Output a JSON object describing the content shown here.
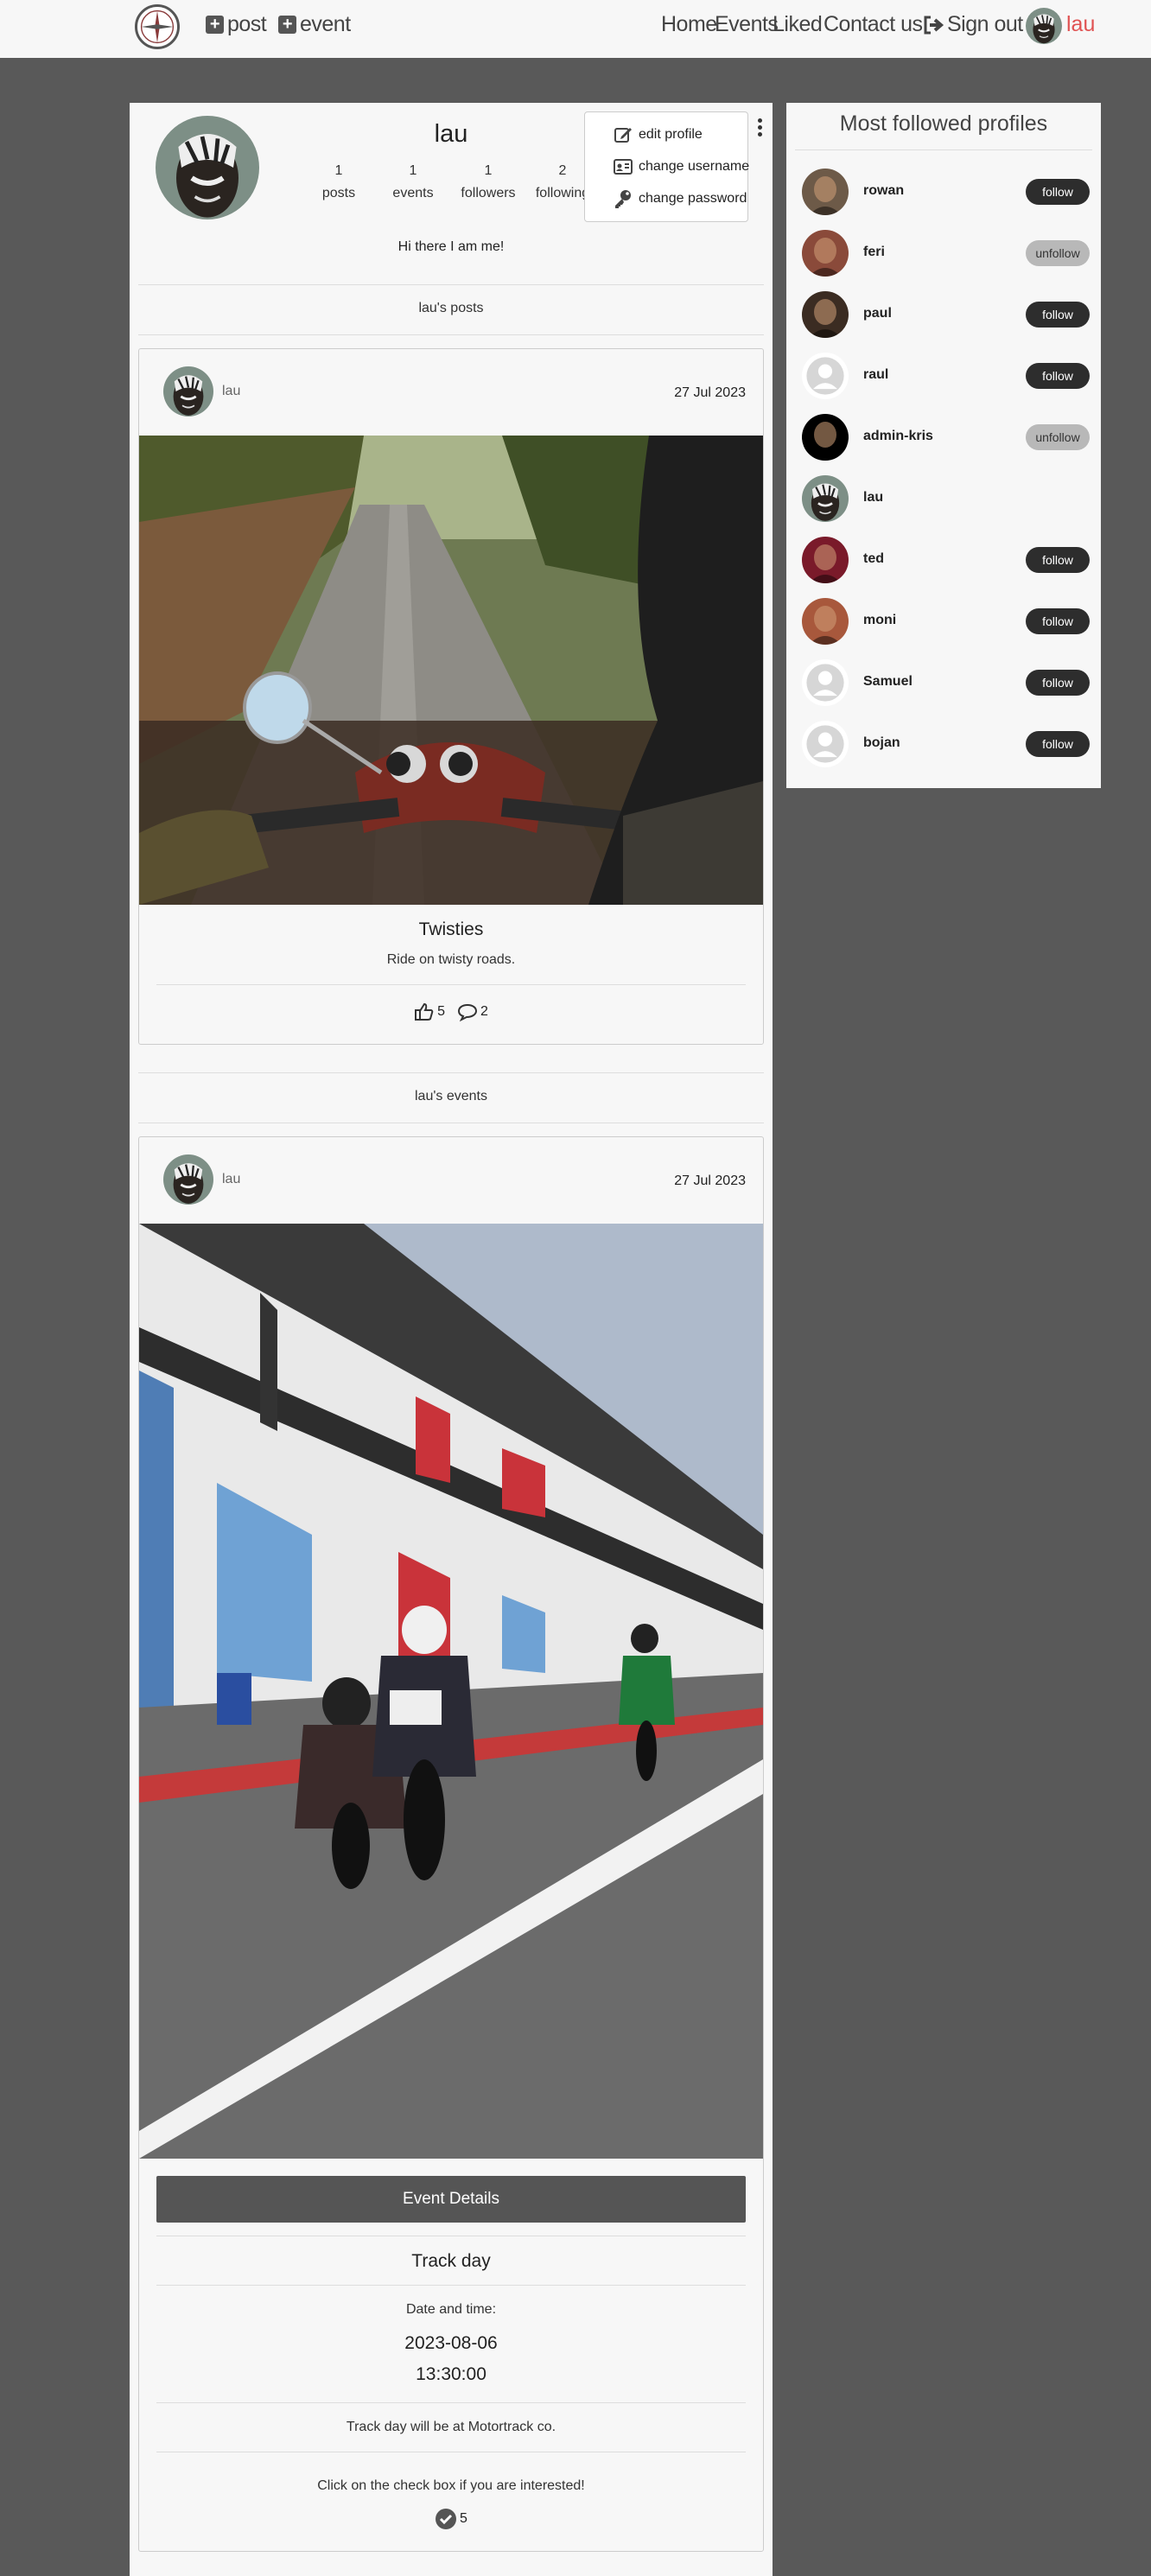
{
  "nav": {
    "post_label": "post",
    "event_label": "event",
    "home": "Home",
    "events": "Events",
    "liked": "Liked",
    "contact": "Contact us",
    "signout": "Sign out",
    "username": "lau"
  },
  "profile": {
    "name": "lau",
    "stats": [
      {
        "value": "1",
        "label": "posts"
      },
      {
        "value": "1",
        "label": "events"
      },
      {
        "value": "1",
        "label": "followers"
      },
      {
        "value": "2",
        "label": "following"
      }
    ],
    "bio": "Hi there I am me!",
    "menu": {
      "edit": "edit profile",
      "username": "change username",
      "password": "change password"
    }
  },
  "posts_heading": "lau's posts",
  "events_heading": "lau's events",
  "post": {
    "user": "lau",
    "date": "27 Jul 2023",
    "title": "Twisties",
    "text": "Ride on twisty roads.",
    "likes": "5",
    "comments": "2"
  },
  "event": {
    "user": "lau",
    "date": "27 Jul 2023",
    "details_label": "Event Details",
    "title": "Track day",
    "datetime_label": "Date and time:",
    "date_value": "2023-08-06",
    "time_value": "13:30:00",
    "description": "Track day will be at Motortrack co.",
    "cta": "Click on the check box if you are interested!",
    "interested": "5"
  },
  "sidebar": {
    "title": "Most followed profiles",
    "profiles": [
      {
        "name": "rowan",
        "button": "follow",
        "state": "follow",
        "avatar": "#6d5a48"
      },
      {
        "name": "feri",
        "button": "unfollow",
        "state": "unfollow",
        "avatar": "#8a4a3a"
      },
      {
        "name": "paul",
        "button": "follow",
        "state": "follow",
        "avatar": "#3b2c22"
      },
      {
        "name": "raul",
        "button": "follow",
        "state": "follow",
        "avatar": "default"
      },
      {
        "name": "admin-kris",
        "button": "unfollow",
        "state": "unfollow",
        "avatar": "#000000"
      },
      {
        "name": "lau",
        "button": "",
        "state": "none",
        "avatar": "lau"
      },
      {
        "name": "ted",
        "button": "follow",
        "state": "follow",
        "avatar": "#7a1a2a"
      },
      {
        "name": "moni",
        "button": "follow",
        "state": "follow",
        "avatar": "#a8583c"
      },
      {
        "name": "Samuel",
        "button": "follow",
        "state": "follow",
        "avatar": "default"
      },
      {
        "name": "bojan",
        "button": "follow",
        "state": "follow",
        "avatar": "default"
      }
    ]
  },
  "colors": {
    "accent_user": "#e05252",
    "page_bg": "#595959",
    "card_bg": "#f7f7f7",
    "follow_btn": "#2d2d2d",
    "unfollow_btn": "#b8b8b8"
  }
}
